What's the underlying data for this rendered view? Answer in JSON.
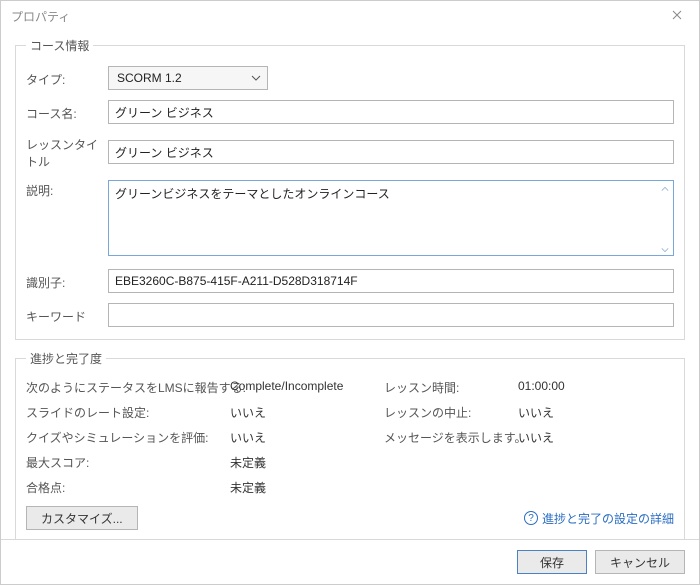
{
  "window": {
    "title": "プロパティ"
  },
  "course_info": {
    "legend": "コース情報",
    "labels": {
      "type": "タイプ:",
      "course_name": "コース名:",
      "lesson_title": "レッスンタイトル",
      "description": "説明:",
      "identifier": "識別子:",
      "keywords": "キーワード"
    },
    "values": {
      "type": "SCORM 1.2",
      "course_name": "グリーン ビジネス",
      "lesson_title": "グリーン ビジネス",
      "description": "グリーンビジネスをテーマとしたオンラインコース",
      "identifier": "EBE3260C-B875-415F-A211-D528D318714F",
      "keywords": ""
    }
  },
  "progress": {
    "legend": "進捗と完了度",
    "rows": [
      {
        "l1": "次のようにステータスをLMSに報告する:",
        "v1": "Complete/Incomplete",
        "l2": "レッスン時間:",
        "v2": "01:00:00"
      },
      {
        "l1": "スライドのレート設定:",
        "v1": "いいえ",
        "l2": "レッスンの中止:",
        "v2": "いいえ"
      },
      {
        "l1": "クイズやシミュレーションを評価:",
        "v1": "いいえ",
        "l2": "メッセージを表示します。",
        "v2": "いいえ"
      },
      {
        "l1": "最大スコア:",
        "v1": "未定義",
        "l2": "",
        "v2": ""
      },
      {
        "l1": "合格点:",
        "v1": "未定義",
        "l2": "",
        "v2": ""
      }
    ],
    "customize_label": "カスタマイズ...",
    "help_label": "進捗と完了の設定の詳細"
  },
  "footer": {
    "save": "保存",
    "cancel": "キャンセル"
  }
}
